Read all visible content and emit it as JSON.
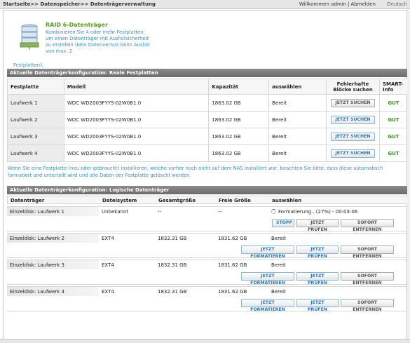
{
  "topbar": {
    "breadcrumb": "Startseite>> Datenspeicher>> Datenträgerverwaltung",
    "welcome": "Willkommen admin",
    "logout": "Abmelden",
    "language": "Deutsch"
  },
  "raid": {
    "title": "RAID 6-Datenträger",
    "description": "Kombinieren Sie 4 oder mehr Festplatten, um einen Datenträger mit Ausfallsicherheit zu erstellen (kein Datenverlust beim Ausfall von max. 2",
    "description_end": "Festplatten)."
  },
  "physical": {
    "section_title": "Aktuelle Datenträgerkonfiguration: Reale Festplatten",
    "headers": {
      "disk": "Festplatte",
      "model": "Modell",
      "capacity": "Kapazität",
      "select": "auswählen",
      "bad_blocks": "Fehlerhafte Blöcke suchen",
      "smart": "SMART-Info"
    },
    "rows": [
      {
        "disk": "Laufwerk 1",
        "model": "WDC WD2003FYYS-02W0B1.0",
        "capacity": "1863.02 GB",
        "status": "Bereit",
        "button": "JETZT SUCHEN",
        "smart": "GUT"
      },
      {
        "disk": "Laufwerk 2",
        "model": "WDC WD2003FYYS-02W0B1.0",
        "capacity": "1863.02 GB",
        "status": "Bereit",
        "button": "JETZT SUCHEN",
        "smart": "GUT"
      },
      {
        "disk": "Laufwerk 3",
        "model": "WDC WD2003FYYS-02W0B1.0",
        "capacity": "1863.02 GB",
        "status": "Bereit",
        "button": "JETZT SUCHEN",
        "smart": "GUT"
      },
      {
        "disk": "Laufwerk 4",
        "model": "WDC WD2003FYYS-02W0B1.0",
        "capacity": "1863.02 GB",
        "status": "Bereit",
        "button": "JETZT SUCHEN",
        "smart": "GUT"
      }
    ]
  },
  "note": "Wenn Sie eine Festplatte (neu oder gebraucht) installieren, welche vorher noch nicht auf dem NAS installiert war, beachten Sie bitte, dass diese automatisch formatiert und unterteilt wird und alle Daten der Festplatte gelöscht werden.",
  "logical": {
    "section_title": "Aktuelle Datenträgerkonfiguration: Logische Datenträger",
    "headers": {
      "volume": "Datenträger",
      "fs": "Dateisystem",
      "total": "Gesamtgröße",
      "free": "Freie Größe",
      "select": "auswählen"
    },
    "rows": [
      {
        "volume": "Einzeldisk: Laufwerk 1",
        "fs": "Unbekannt",
        "total": "--",
        "free": "--",
        "status": "Formatierung...(27%) - 00:03:06",
        "buttons": [
          "STOPP",
          "JETZT PRÜFEN",
          "SOFORT ENTFERNEN"
        ]
      },
      {
        "volume": "Einzeldisk: Laufwerk 2",
        "fs": "EXT4",
        "total": "1832.31 GB",
        "free": "1831.62 GB",
        "status": "Bereit",
        "buttons": [
          "JETZT FORMATIEREN",
          "JETZT PRÜFEN",
          "SOFORT ENTFERNEN"
        ]
      },
      {
        "volume": "Einzeldisk: Laufwerk 3",
        "fs": "EXT4",
        "total": "1832.31 GB",
        "free": "1831.62 GB",
        "status": "Bereit",
        "buttons": [
          "JETZT FORMATIEREN",
          "JETZT PRÜFEN",
          "SOFORT ENTFERNEN"
        ]
      },
      {
        "volume": "Einzeldisk: Laufwerk 4",
        "fs": "EXT4",
        "total": "1832.31 GB",
        "free": "1831.62 GB",
        "status": "Bereit",
        "buttons": [
          "JETZT FORMATIEREN",
          "JETZT PRÜFEN",
          "SOFORT ENTFERNEN"
        ]
      }
    ]
  },
  "colors": {
    "accent_blue": "#3a8fd0",
    "ok_green": "#2f9a1b",
    "header_gray": "#777777"
  }
}
